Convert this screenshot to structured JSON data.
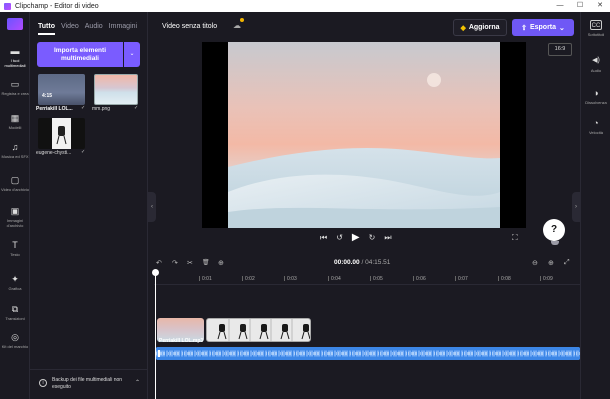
{
  "window": {
    "title": "Clipchamp - Editor di video",
    "controls": [
      "—",
      "☐",
      "✕"
    ]
  },
  "rail": {
    "items": [
      {
        "label": "I tuoi multimediali",
        "icon": "folder-icon",
        "glyph": "▬",
        "active": true
      },
      {
        "label": "Registra e crea",
        "icon": "camera-icon",
        "glyph": "▭",
        "active": false
      },
      {
        "label": "Modelli",
        "icon": "templates-icon",
        "glyph": "▦",
        "active": false
      },
      {
        "label": "Musica ed SFX",
        "icon": "music-icon",
        "glyph": "♫",
        "active": false
      },
      {
        "label": "Video d'archivio",
        "icon": "stock-video-icon",
        "glyph": "▢",
        "active": false
      },
      {
        "label": "Immagini d'archivio",
        "icon": "stock-image-icon",
        "glyph": "▣",
        "active": false
      },
      {
        "label": "Testo",
        "icon": "text-icon",
        "glyph": "T",
        "active": false
      },
      {
        "label": "Grafica",
        "icon": "graphics-icon",
        "glyph": "✦",
        "active": false
      },
      {
        "label": "Transizioni",
        "icon": "transitions-icon",
        "glyph": "⧉",
        "active": false
      },
      {
        "label": "Kit del marchio",
        "icon": "brand-kit-icon",
        "glyph": "◎",
        "active": false
      }
    ]
  },
  "library": {
    "tabs": [
      "Tutto",
      "Video",
      "Audio",
      "Immagini"
    ],
    "active_tab": "Tutto",
    "import_label": "Importa elementi multimediali",
    "import_dropdown": "⌄",
    "items": [
      {
        "label": "Perriakill LOL...",
        "duration": "4:15"
      },
      {
        "label": "mm.png",
        "duration": ""
      },
      {
        "label": "eugene-chysti...",
        "duration": ""
      }
    ],
    "backup_text": "Backup dei file multimediali non eseguito",
    "backup_chevron": "⌃"
  },
  "toolbar": {
    "project_title": "Video senza titolo",
    "upgrade_label": "Aggiorna",
    "export_label": "Esporta",
    "export_icon": "⇧",
    "export_chevron": "⌄",
    "aspect_ratio": "16:9"
  },
  "player": {
    "controls": [
      "⏮",
      "↺",
      "▶",
      "↻",
      "⏭"
    ],
    "fullscreen": "⛶",
    "help": "?"
  },
  "right_rail": {
    "items": [
      {
        "label": "Sottotitoli",
        "icon": "captions-icon",
        "glyph": "CC"
      },
      {
        "label": "Audio",
        "icon": "audio-icon",
        "glyph": "◀)"
      },
      {
        "label": "Dissolvenza",
        "icon": "fade-icon",
        "glyph": "◑"
      },
      {
        "label": "Velocità",
        "icon": "speed-icon",
        "glyph": "◔"
      }
    ]
  },
  "timeline": {
    "tools": [
      "↶",
      "↷",
      "✂",
      "🗑",
      "⊕"
    ],
    "current_time": "00:00.00",
    "separator": " / ",
    "total_time": "04:15.51",
    "zoom": [
      "⊖",
      "⊕",
      "⤢"
    ],
    "ticks": [
      "0:01",
      "0:02",
      "0:03",
      "0:04",
      "0:05",
      "0:06",
      "0:07",
      "0:08",
      "0:09"
    ],
    "clip_label": "Perriakill LOL.mp3"
  },
  "colors": {
    "accent": "#7a5cff",
    "export": "#6f58f5",
    "audio_track": "#3c86e6",
    "background": "#1b1a22"
  }
}
